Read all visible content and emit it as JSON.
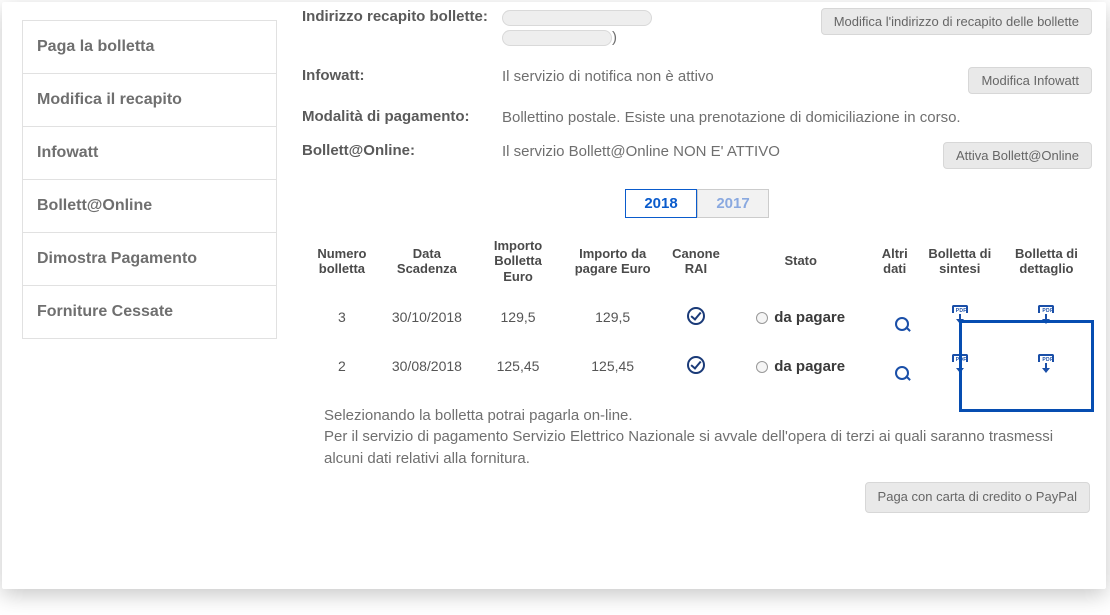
{
  "sidebar": {
    "items": [
      {
        "label": "Paga la bolletta"
      },
      {
        "label": "Modifica il recapito"
      },
      {
        "label": "Infowatt"
      },
      {
        "label": "Bollett@Online"
      },
      {
        "label": "Dimostra Pagamento"
      },
      {
        "label": "Forniture Cessate"
      }
    ]
  },
  "details": {
    "indirizzo_label": "Indirizzo recapito bollette:",
    "indirizzo_suffix": ")",
    "indirizzo_btn": "Modifica l'indirizzo di recapito delle bollette",
    "infowatt_label": "Infowatt:",
    "infowatt_value": "Il servizio di notifica non è attivo",
    "infowatt_btn": "Modifica Infowatt",
    "modalita_label": "Modalità di pagamento:",
    "modalita_value": "Bollettino postale. Esiste una prenotazione di domiciliazione in corso.",
    "bonline_label": "Bollett@Online:",
    "bonline_value": "Il servizio Bollett@Online NON E' ATTIVO",
    "bonline_btn": "Attiva Bollett@Online"
  },
  "years": {
    "active": "2018",
    "inactive": "2017"
  },
  "table": {
    "headers": {
      "numero": "Numero bolletta",
      "data": "Data Scadenza",
      "importo": "Importo Bolletta Euro",
      "importo_pagare": "Importo da pagare Euro",
      "canone": "Canone RAI",
      "stato": "Stato",
      "altri": "Altri dati",
      "sintesi": "Bolletta di sintesi",
      "dettaglio": "Bolletta di dettaglio"
    },
    "rows": [
      {
        "num": "3",
        "data": "30/10/2018",
        "importo": "129,5",
        "da_pagare": "129,5",
        "stato": "da pagare"
      },
      {
        "num": "2",
        "data": "30/08/2018",
        "importo": "125,45",
        "da_pagare": "125,45",
        "stato": "da pagare"
      }
    ]
  },
  "footer": {
    "line1": "Selezionando la bolletta potrai pagarla on-line.",
    "line2": "Per il servizio di pagamento Servizio Elettrico Nazionale si avvale dell'opera di terzi ai quali saranno trasmessi alcuni dati relativi alla fornitura.",
    "pay_btn": "Paga con carta di credito o PayPal"
  }
}
